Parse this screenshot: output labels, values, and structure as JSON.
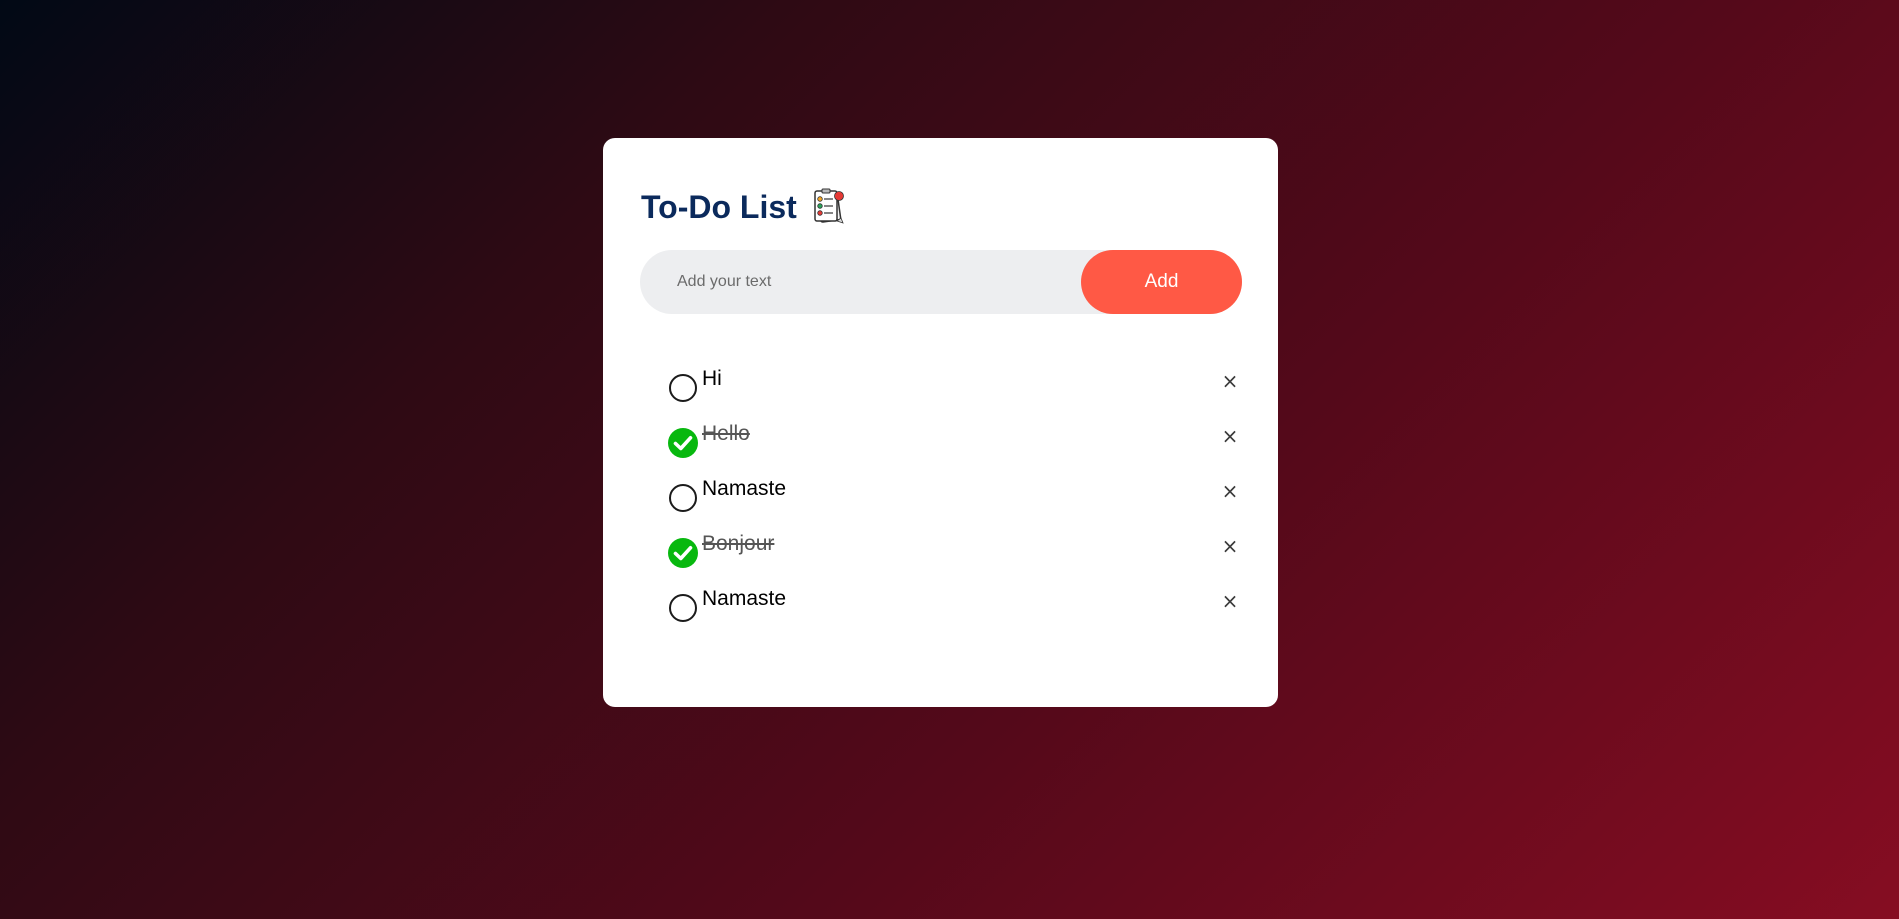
{
  "app": {
    "title": "To-Do List",
    "title_icon": "checklist-clipboard-icon",
    "colors": {
      "title": "#0b2a5c",
      "add_button": "#ff5945",
      "checked": "#08b80f",
      "input_background": "#edeef0"
    }
  },
  "input": {
    "value": "",
    "placeholder": "Add your text"
  },
  "add_button": {
    "label": "Add"
  },
  "tasks": [
    {
      "text": "Hi",
      "done": false,
      "remove_label": "×"
    },
    {
      "text": "Hello",
      "done": true,
      "remove_label": "×"
    },
    {
      "text": "Namaste",
      "done": false,
      "remove_label": "×"
    },
    {
      "text": "Bonjour",
      "done": true,
      "remove_label": "×"
    },
    {
      "text": "Namaste",
      "done": false,
      "remove_label": "×"
    }
  ]
}
